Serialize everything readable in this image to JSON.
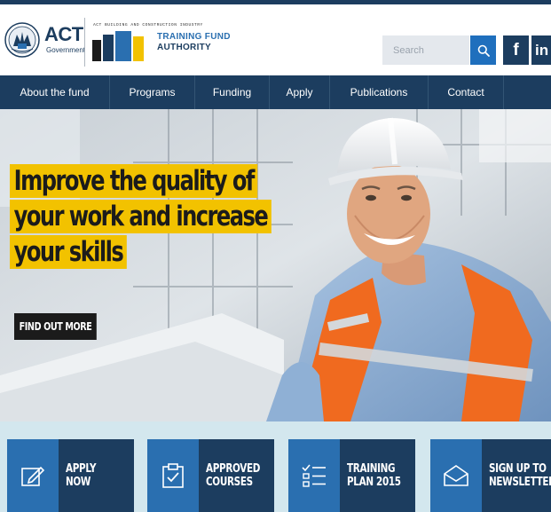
{
  "brand": {
    "act_word": "ACT",
    "act_sub": "Government",
    "tfa_small": "ACT BUILDING AND CONSTRUCTION INDUSTRY",
    "tfa_line1": "TRAINING FUND",
    "tfa_line2": "AUTHORITY"
  },
  "header": {
    "search_placeholder": "Search",
    "search_icon": "search-icon",
    "social": [
      {
        "name": "facebook-icon",
        "glyph": "f"
      },
      {
        "name": "linkedin-icon",
        "glyph": "in"
      }
    ]
  },
  "nav": {
    "items": [
      {
        "label": "About the fund"
      },
      {
        "label": "Programs"
      },
      {
        "label": "Funding"
      },
      {
        "label": "Apply"
      },
      {
        "label": "Publications"
      },
      {
        "label": "Contact"
      }
    ]
  },
  "hero": {
    "headline_lines": [
      "Improve the quality of",
      "your work and increase",
      "your skills"
    ],
    "cta_label": "FIND OUT MORE"
  },
  "tiles": [
    {
      "label": "APPLY NOW",
      "icon": "pencil-edit-icon"
    },
    {
      "label": "APPROVED\nCOURSES",
      "icon": "clipboard-check-icon"
    },
    {
      "label": "TRAINING\nPLAN 2015",
      "icon": "checklist-icon"
    },
    {
      "label": "SIGN UP TO\nNEWSLETTER",
      "icon": "envelope-icon"
    }
  ],
  "colors": {
    "navy": "#1c3d5f",
    "accent_blue": "#2a6fb0",
    "highlight_yellow": "#f2c200",
    "tile_strip": "#d3e7ee"
  }
}
